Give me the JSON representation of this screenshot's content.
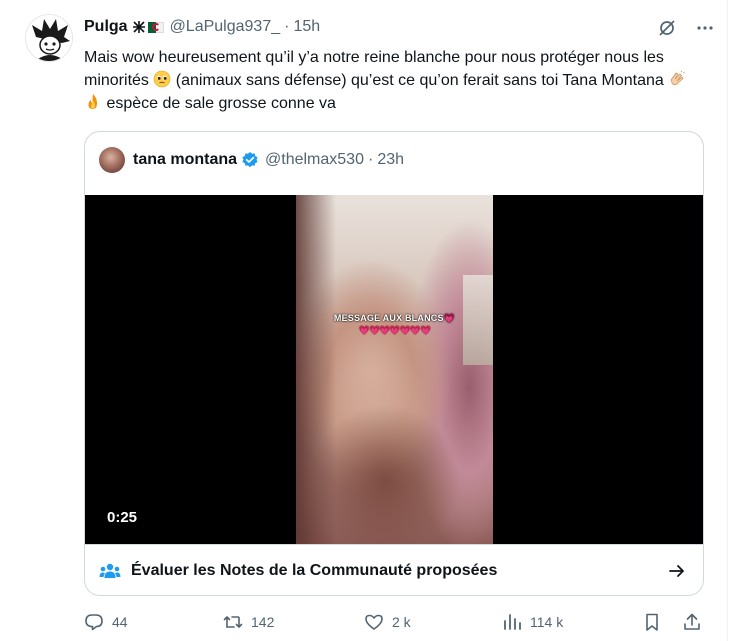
{
  "tweet": {
    "author": {
      "display_name": "Pulga",
      "name_emojis": [
        "ideograph-icon",
        "algeria-flag-icon"
      ],
      "handle": "@LaPulga937_",
      "time": "15h",
      "avatar": "cartoon-character-avatar"
    },
    "text_parts": {
      "line1": "Mais wow heureusement qu’il y’a notre reine blanche pour nous protéger nous les minorités ",
      "line2": " (animaux sans défense) qu’est ce qu’on ferait sans toi Tana Montana ",
      "line3": " espèce de sale grosse conne va"
    },
    "text_emojis": [
      "pleading-face-emoji",
      "clapping-hands-emoji",
      "fire-emoji"
    ],
    "top_icons": [
      "grok-icon",
      "more-icon"
    ]
  },
  "quote": {
    "display_name": "tana montana",
    "verified": true,
    "handle": "@thelmax530",
    "time": "23h",
    "video": {
      "caption": "MESSAGE AUX BLANCS💗",
      "hearts": "💗💗💗💗💗💗💗",
      "duration": "0:25"
    },
    "community_notes": {
      "label": "Évaluer les Notes de la Communauté proposées"
    }
  },
  "actions": {
    "reply_count": "44",
    "retweet_count": "142",
    "like_count": "2 k",
    "views_count": "114 k"
  },
  "colors": {
    "text_primary": "#0f1419",
    "text_secondary": "#536471",
    "border": "#cfd9de",
    "verified": "#1d9bf0",
    "accent": "#1d9bf0"
  }
}
